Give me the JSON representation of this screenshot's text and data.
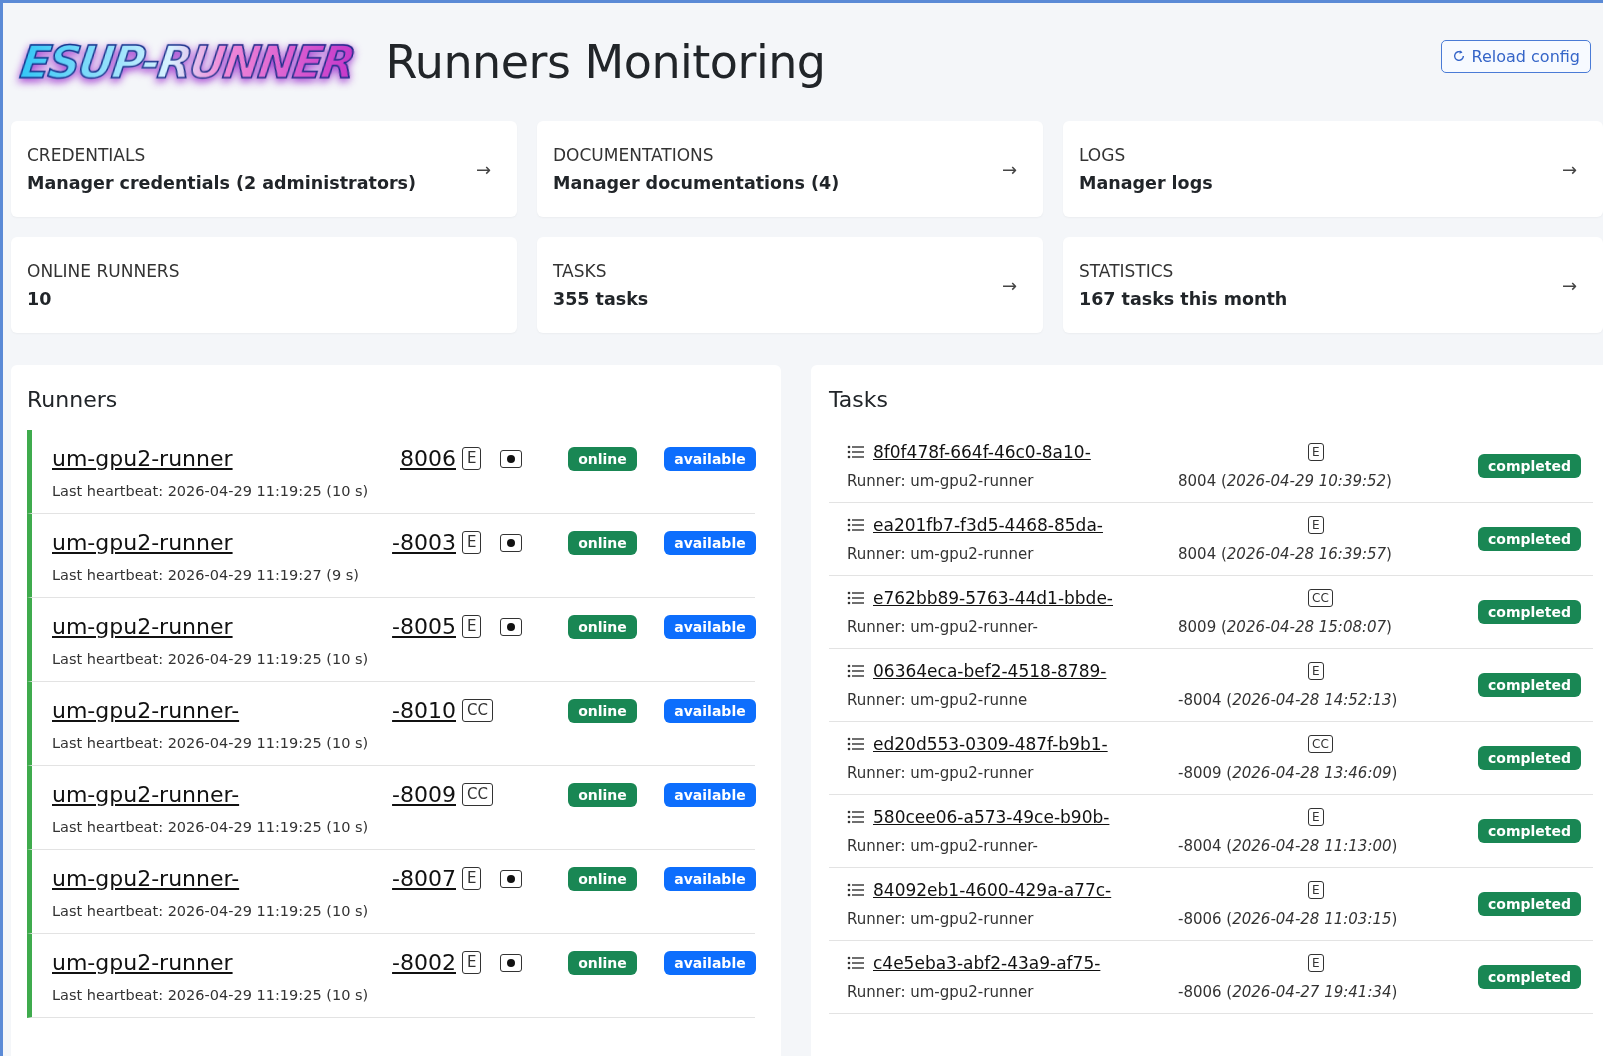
{
  "header": {
    "logo": "ESUP-RUNNER",
    "title": "Runners Monitoring",
    "reload_button": "Reload config"
  },
  "cards": [
    {
      "label": "CREDENTIALS",
      "value": "Manager credentials (2 administrators)",
      "arrow": "→"
    },
    {
      "label": "DOCUMENTATIONS",
      "value": "Manager documentations (4)",
      "arrow": "→"
    },
    {
      "label": "LOGS",
      "value": "Manager logs",
      "arrow": "→"
    },
    {
      "label": "ONLINE RUNNERS",
      "value": "10"
    },
    {
      "label": "TASKS",
      "value": "355 tasks",
      "arrow": "→"
    },
    {
      "label": "STATISTICS",
      "value": "167 tasks this month",
      "arrow": "→"
    }
  ],
  "runners": {
    "title": "Runners",
    "items": [
      {
        "name": "um-gpu2-runner",
        "port": "8006",
        "tag": "E",
        "record": true,
        "status": "online",
        "availability": "available",
        "heartbeat": "Last heartbeat: 2026-04-29 11:19:25 (10 s)"
      },
      {
        "name": "um-gpu2-runner",
        "port": "-8003",
        "tag": "E",
        "record": true,
        "status": "online",
        "availability": "available",
        "heartbeat": "Last heartbeat: 2026-04-29 11:19:27 (9 s)"
      },
      {
        "name": "um-gpu2-runner",
        "port": "-8005",
        "tag": "E",
        "record": true,
        "status": "online",
        "availability": "available",
        "heartbeat": "Last heartbeat: 2026-04-29 11:19:25 (10 s)"
      },
      {
        "name": "um-gpu2-runner-",
        "port": "-8010",
        "tag": "CC",
        "record": false,
        "status": "online",
        "availability": "available",
        "heartbeat": "Last heartbeat: 2026-04-29 11:19:25 (10 s)"
      },
      {
        "name": "um-gpu2-runner-",
        "port": "-8009",
        "tag": "CC",
        "record": false,
        "status": "online",
        "availability": "available",
        "heartbeat": "Last heartbeat: 2026-04-29 11:19:25 (10 s)"
      },
      {
        "name": "um-gpu2-runner-",
        "port": "-8007",
        "tag": "E",
        "record": true,
        "status": "online",
        "availability": "available",
        "heartbeat": "Last heartbeat: 2026-04-29 11:19:25 (10 s)"
      },
      {
        "name": "um-gpu2-runner",
        "port": "-8002",
        "tag": "E",
        "record": true,
        "status": "online",
        "availability": "available",
        "heartbeat": "Last heartbeat: 2026-04-29 11:19:25 (10 s)"
      }
    ]
  },
  "tasks": {
    "title": "Tasks",
    "items": [
      {
        "id": "8f0f478f-664f-46c0-8a10-",
        "tag": "E",
        "runner": "Runner: um-gpu2-runner",
        "detail": "8004 (*2026-04-29 10:39:52*)",
        "status": "completed"
      },
      {
        "id": "ea201fb7-f3d5-4468-85da-",
        "tag": "E",
        "runner": "Runner: um-gpu2-runner",
        "detail": "8004 (*2026-04-28 16:39:57*)",
        "status": "completed"
      },
      {
        "id": "e762bb89-5763-44d1-bbde-",
        "tag": "CC",
        "runner": "Runner: um-gpu2-runner-",
        "detail": "8009 (*2026-04-28 15:08:07*)",
        "status": "completed"
      },
      {
        "id": "06364eca-bef2-4518-8789-",
        "tag": "E",
        "runner": "Runner: um-gpu2-runne",
        "detail": "-8004 (*2026-04-28 14:52:13*)",
        "status": "completed"
      },
      {
        "id": "ed20d553-0309-487f-b9b1-",
        "tag": "CC",
        "runner": "Runner: um-gpu2-runner",
        "detail": "-8009 (*2026-04-28 13:46:09*)",
        "status": "completed"
      },
      {
        "id": "580cee06-a573-49ce-b90b-",
        "tag": "E",
        "runner": "Runner: um-gpu2-runner-",
        "detail": "-8004 (*2026-04-28 11:13:00*)",
        "status": "completed"
      },
      {
        "id": "84092eb1-4600-429a-a77c-",
        "tag": "E",
        "runner": "Runner: um-gpu2-runner",
        "detail": "-8006 (*2026-04-28 11:03:15*)",
        "status": "completed"
      },
      {
        "id": "c4e5eba3-abf2-43a9-af75-",
        "tag": "E",
        "runner": "Runner: um-gpu2-runner",
        "detail": "-8006 (*2026-04-27 19:41:34*)",
        "status": "completed"
      }
    ]
  }
}
